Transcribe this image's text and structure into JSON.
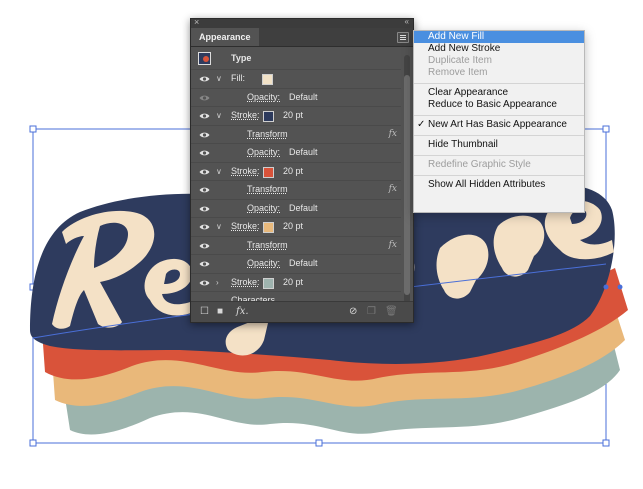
{
  "panel": {
    "tab_title": "Appearance",
    "close_glyph": "×",
    "collapse_glyph": "«",
    "header_label": "Type",
    "rows": [
      {
        "twisty": "∨",
        "label": "Fill:",
        "value": "",
        "swatch": "#f2e2c7",
        "fx": false
      },
      {
        "twisty": "",
        "label": "Opacity:",
        "value": "Default",
        "swatch": "",
        "fx": false
      },
      {
        "twisty": "∨",
        "label": "Stroke:",
        "value": "20 pt",
        "swatch": "#2d3a5c",
        "fx": false
      },
      {
        "twisty": "",
        "label": "Transform",
        "value": "",
        "swatch": "",
        "fx": true
      },
      {
        "twisty": "",
        "label": "Opacity:",
        "value": "Default",
        "swatch": "",
        "fx": false
      },
      {
        "twisty": "∨",
        "label": "Stroke:",
        "value": "20 pt",
        "swatch": "#d9533a",
        "fx": false
      },
      {
        "twisty": "",
        "label": "Transform",
        "value": "",
        "swatch": "",
        "fx": true
      },
      {
        "twisty": "",
        "label": "Opacity:",
        "value": "Default",
        "swatch": "",
        "fx": false
      },
      {
        "twisty": "∨",
        "label": "Stroke:",
        "value": "20 pt",
        "swatch": "#e8b97c",
        "fx": false
      },
      {
        "twisty": "",
        "label": "Transform",
        "value": "",
        "swatch": "",
        "fx": true
      },
      {
        "twisty": "",
        "label": "Opacity:",
        "value": "Default",
        "swatch": "",
        "fx": false
      },
      {
        "twisty": "›",
        "label": "Stroke:",
        "value": "20 pt",
        "swatch": "#9eb3ae",
        "fx": false
      },
      {
        "twisty": "",
        "label": "Characters",
        "value": "",
        "swatch": "",
        "fx": false
      }
    ],
    "fx_glyph": "fx",
    "bottom_fx": "fx."
  },
  "menu": {
    "items": [
      {
        "label": "Add New Fill",
        "state": "highlighted"
      },
      {
        "label": "Add New Stroke",
        "state": "enabled"
      },
      {
        "label": "Duplicate Item",
        "state": "disabled"
      },
      {
        "label": "Remove Item",
        "state": "disabled"
      },
      {
        "sep": true
      },
      {
        "label": "Clear Appearance",
        "state": "enabled"
      },
      {
        "label": "Reduce to Basic Appearance",
        "state": "enabled"
      },
      {
        "sep": true
      },
      {
        "label": "New Art Has Basic Appearance",
        "state": "checked"
      },
      {
        "sep": true
      },
      {
        "label": "Hide Thumbnail",
        "state": "enabled"
      },
      {
        "sep": true
      },
      {
        "label": "Redefine Graphic Style",
        "state": "disabled"
      },
      {
        "sep": true
      },
      {
        "label": "Show All Hidden Attributes",
        "state": "enabled"
      }
    ],
    "check_glyph": "✓"
  },
  "artwork": {
    "colors": {
      "navy": "#2e3b5e",
      "red": "#d9533a",
      "tan": "#e9b87a",
      "sage": "#9cb4ad",
      "cream": "#f4e1c6",
      "selection": "#4a6fd8"
    }
  }
}
